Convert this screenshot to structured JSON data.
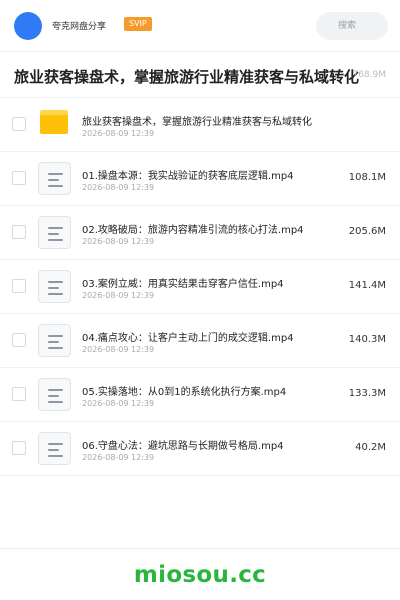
{
  "header": {
    "share_name": "夸克网盘分享",
    "badge": "SVIP",
    "search_placeholder": "搜索",
    "avatar_color": "#2f7bf5",
    "badge_color": "#f59a2b"
  },
  "title": {
    "text": "旅业获客操盘术，掌握旅游行业精准获客与私域转化",
    "total_size": "768.9M"
  },
  "files": [
    {
      "type": "folder",
      "icon": "folder-icon",
      "name": "旅业获客操盘术，掌握旅游行业精准获客与私域转化",
      "date": "2026-08-09 12:39",
      "size": ""
    },
    {
      "type": "file",
      "icon": "file-icon",
      "name": "01.操盘本源：我实战验证的获客底层逻辑.mp4",
      "date": "2026-08-09 12:39",
      "size": "108.1M"
    },
    {
      "type": "file",
      "icon": "file-icon",
      "name": "02.攻略破局：旅游内容精准引流的核心打法.mp4",
      "date": "2026-08-09 12:39",
      "size": "205.6M"
    },
    {
      "type": "file",
      "icon": "file-icon",
      "name": "03.案例立威：用真实结果击穿客户信任.mp4",
      "date": "2026-08-09 12:39",
      "size": "141.4M"
    },
    {
      "type": "file",
      "icon": "file-icon",
      "name": "04.痛点攻心：让客户主动上门的成交逻辑.mp4",
      "date": "2026-08-09 12:39",
      "size": "140.3M"
    },
    {
      "type": "file",
      "icon": "file-icon",
      "name": "05.实操落地：从0到1的系统化执行方案.mp4",
      "date": "2026-08-09 12:39",
      "size": "133.3M"
    },
    {
      "type": "file",
      "icon": "file-icon",
      "name": "06.守盘心法：避坑思路与长期做号格局.mp4",
      "date": "2026-08-09 12:39",
      "size": "40.2M"
    }
  ],
  "watermark": {
    "text": "miosou.cc",
    "color": "#2bb53c"
  }
}
